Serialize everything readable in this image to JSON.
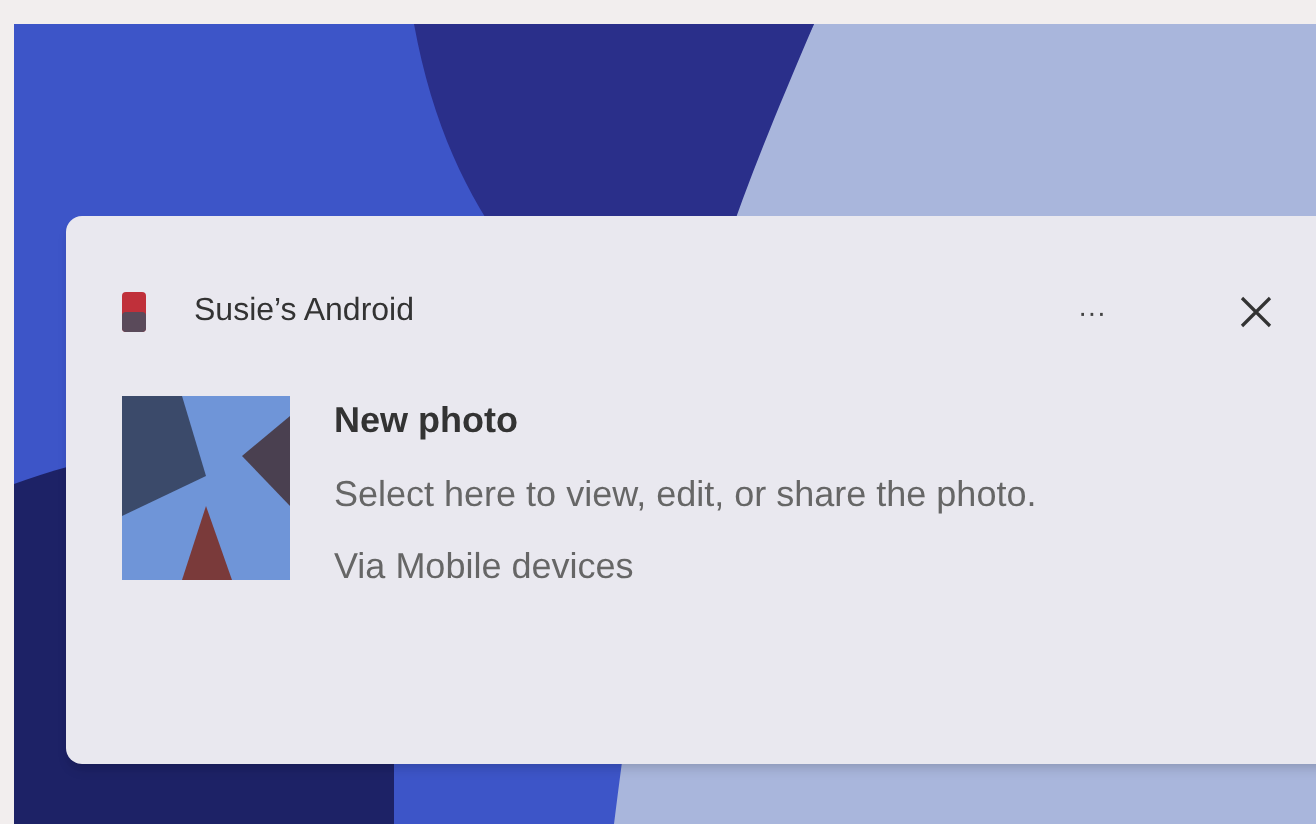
{
  "notification": {
    "app_name": "Susie’s Android",
    "more_button": "···",
    "title": "New photo",
    "body": "Select here to view, edit, or share the photo.",
    "source": "Via Mobile devices"
  }
}
